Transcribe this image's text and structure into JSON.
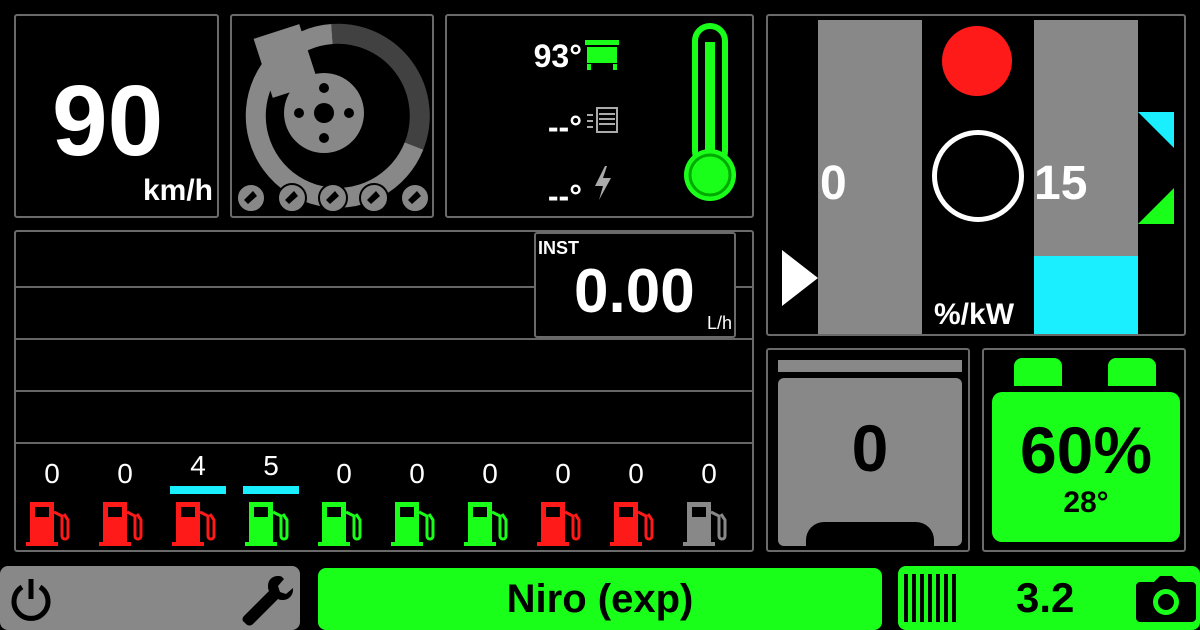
{
  "speed": {
    "value": "90",
    "unit": "km/h"
  },
  "temps": {
    "coolant": "93°",
    "ambient": "--°",
    "battery": "--°"
  },
  "power": {
    "left_value": "0",
    "right_value": "15",
    "unit": "%/kW"
  },
  "fuel": {
    "label": "INST",
    "value": "0.00",
    "unit": "L/h",
    "pumps": [
      {
        "count": "0",
        "color": "#ff1a1a"
      },
      {
        "count": "0",
        "color": "#ff1a1a"
      },
      {
        "count": "4",
        "color": "#ff1a1a",
        "marker": true
      },
      {
        "count": "5",
        "color": "#1aff1a",
        "marker": true
      },
      {
        "count": "0",
        "color": "#1aff1a"
      },
      {
        "count": "0",
        "color": "#1aff1a"
      },
      {
        "count": "0",
        "color": "#1aff1a"
      },
      {
        "count": "0",
        "color": "#ff1a1a"
      },
      {
        "count": "0",
        "color": "#ff1a1a"
      },
      {
        "count": "0",
        "color": "#888888"
      }
    ]
  },
  "gear": {
    "value": "0"
  },
  "battery": {
    "soc": "60%",
    "temp": "28°"
  },
  "footer": {
    "car_name": "Niro (exp)",
    "version": "3.2"
  },
  "colors": {
    "accent_green": "#1aff1a",
    "cyan": "#1aefff",
    "red": "#ff1a1a",
    "gray": "#888888"
  }
}
